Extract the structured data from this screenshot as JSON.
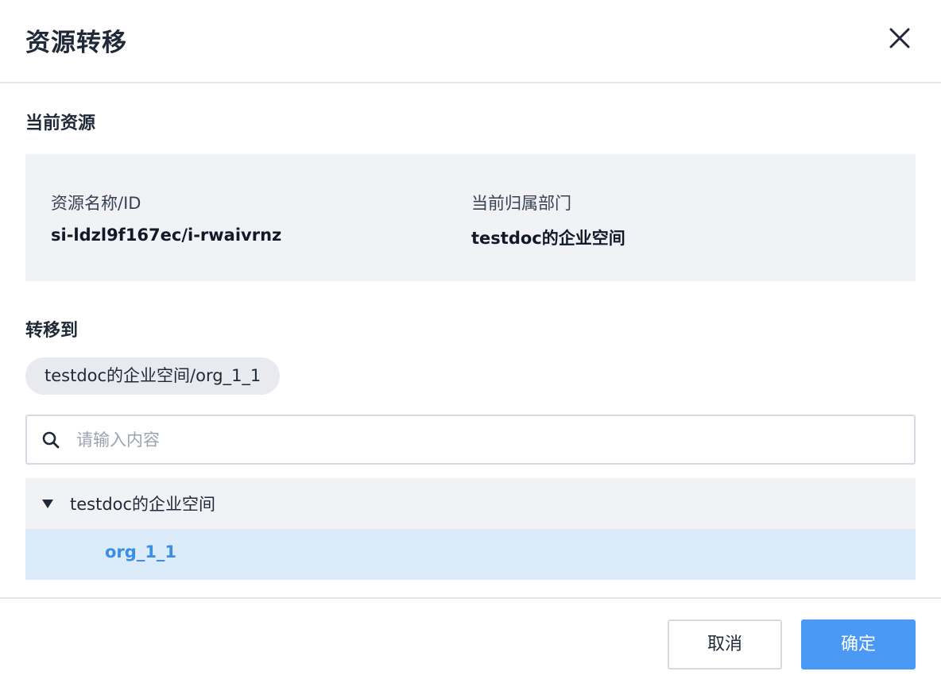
{
  "dialog": {
    "title": "资源转移",
    "close_icon": "close-icon"
  },
  "current": {
    "section_label": "当前资源",
    "name_label": "资源名称/ID",
    "name_value": "si-ldzl9f167ec/i-rwaivrnz",
    "dept_label": "当前归属部门",
    "dept_value": "testdoc的企业空间"
  },
  "target": {
    "section_label": "转移到",
    "selected_path": "testdoc的企业空间/org_1_1",
    "search": {
      "placeholder": "请输入内容",
      "value": "",
      "icon": "search-icon"
    },
    "tree": {
      "parent_label": "testdoc的企业空间",
      "parent_expanded": true,
      "child_label": "org_1_1",
      "child_selected": true
    }
  },
  "footer": {
    "cancel_label": "取消",
    "ok_label": "确定"
  },
  "colors": {
    "primary": "#4a9af5",
    "selected_row_bg": "#dcebfa",
    "selected_text": "#3a8ee6",
    "panel_bg": "#f1f2f6"
  }
}
